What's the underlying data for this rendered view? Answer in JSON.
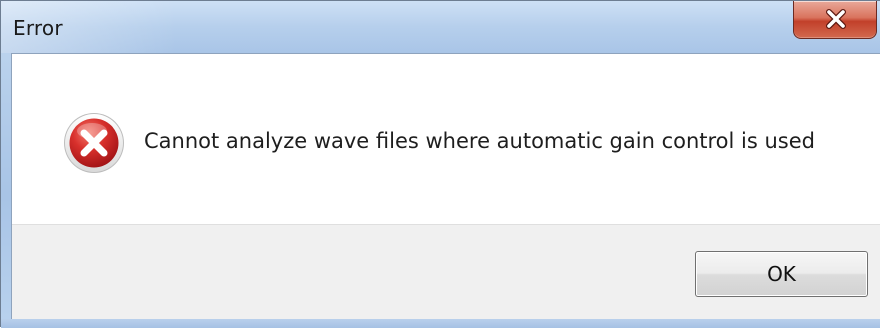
{
  "window": {
    "title": "Error"
  },
  "titlebar": {
    "close_icon": "close-x-icon",
    "close_color": "#c7432b"
  },
  "dialog": {
    "icon": "error-icon",
    "icon_color": "#c8262b",
    "message": "Cannot analyze wave files where automatic gain control is used"
  },
  "buttons": {
    "ok_label": "OK"
  }
}
